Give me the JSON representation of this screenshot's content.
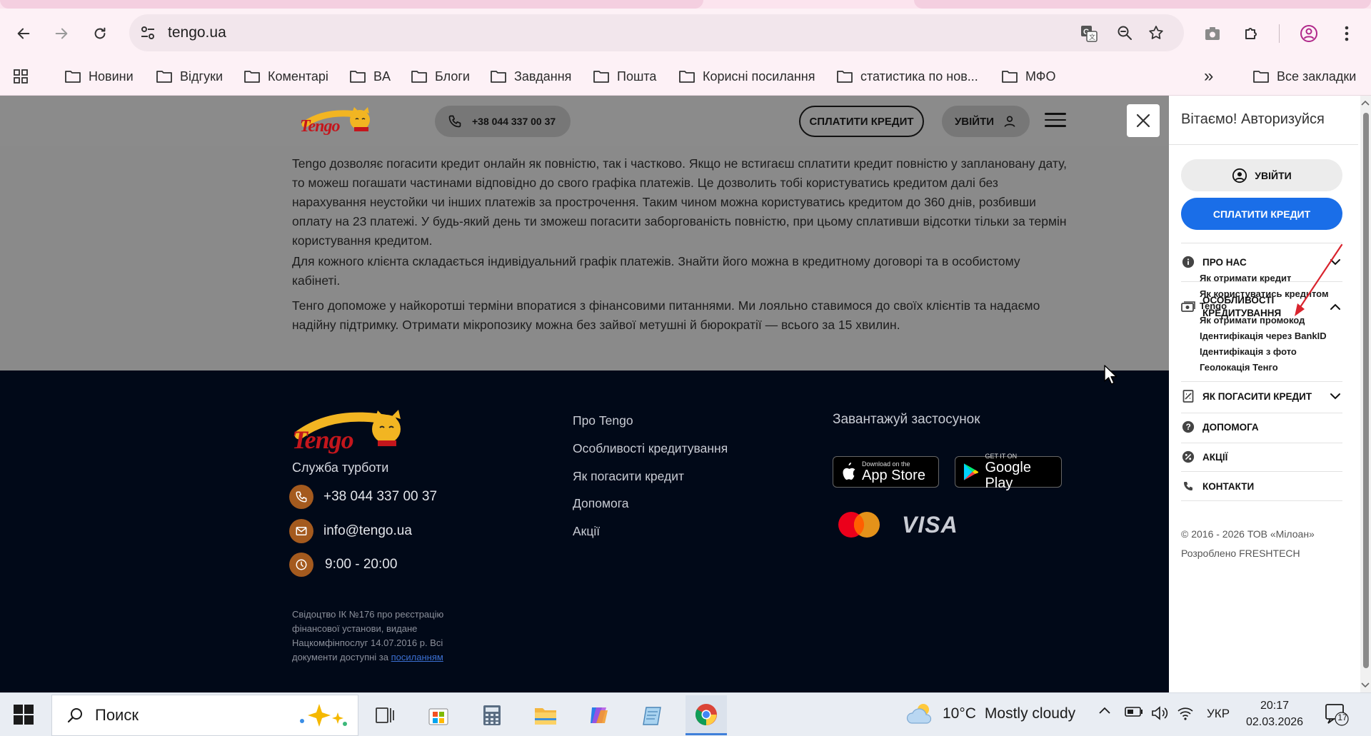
{
  "browser": {
    "url": "tengo.ua",
    "bookmarks": [
      "Новини",
      "Відгуки",
      "Коментарі",
      "BA",
      "Блоги",
      "Завдання",
      "Пошта",
      "Корисні посилання",
      "статистика по нов...",
      "МФО"
    ],
    "all_bookmarks": "Все закладки",
    "more_glyph": "»"
  },
  "site": {
    "logo_text": "Tengo",
    "phone": "+38 044 337 00 37",
    "pay_label": "СПЛАТИТИ КРЕДИТ",
    "login_label": "УВІЙТИ",
    "paragraphs": [
      "Tengo дозволяє погасити кредит онлайн як повністю, так і частково. Якщо не встигаєш сплатити кредит повністю у заплановану дату, то можеш погашати частинами відповідно до свого графіка платежів. Це дозволить тобі користуватись кредитом далі без нарахування неустойки чи інших платежів за прострочення. Таким чином можна користуватись кредитом до 360 днів, розбивши оплату на 23 платежі. У будь-який день ти зможеш погасити заборгованість повністю, при цьому сплативши відсотки тільки за термін користування кредитом.",
      "Для кожного клієнта складається індивідуальний графік платежів. Знайти його можна в кредитному договорі та в особистому кабінеті.",
      "Тенго допоможе у найкоротші терміни впоратися з фінансовими питаннями. Ми лояльно ставимося до своїх клієнтів та надаємо надійну підтримку. Отримати мікропозику можна без зайвої метушні й бюрократії — всього за 15 хвилин."
    ]
  },
  "footer": {
    "service_title": "Служба турботи",
    "phone": "+38 044 337 00 37",
    "email": "info@tengo.ua",
    "hours": "9:00 - 20:00",
    "license_text": "Свідоцтво ІК №176 про реєстрацію фінансової установи, видане Нацкомфінпослуг 14.07.2016 р. Всі документи доступні за",
    "license_link": "посиланням",
    "links": [
      "Про Tengo",
      "Особливості кредитування",
      "Як погасити кредит",
      "Допомога",
      "Акції"
    ],
    "app_title": "Завантажуй застосунок",
    "appstore_small": "Download on the",
    "appstore_big": "App Store",
    "gplay_small": "GET IT ON",
    "gplay_big": "Google Play",
    "visa": "VISA"
  },
  "panel": {
    "greeting": "Вітаємо! Авторизуйся",
    "login": "УВІЙТИ",
    "pay": "СПЛАТИТИ КРЕДИТ",
    "about": "ПРО НАС",
    "features_line1": "ОСОБЛИВОСТІ",
    "features_line2": "КРЕДИТУВАННЯ",
    "subitems": [
      "Як отримати кредит",
      "Як користуватись кредитом Tengo",
      "Як отримати промокод",
      "Ідентифікація через BankID",
      "Ідентифікація з фото",
      "Геолокація Тенго"
    ],
    "repay": "ЯК ПОГАСИТИ КРЕДИТ",
    "help": "ДОПОМОГА",
    "promo": "АКЦІЇ",
    "contacts": "КОНТАКТИ",
    "copyright": "© 2016 - 2026 ТОВ «Мілоан»",
    "developer": "Розроблено FRESHTECH"
  },
  "taskbar": {
    "search_placeholder": "Поиск",
    "temperature": "10°C",
    "weather": "Mostly cloudy",
    "lang": "УКР",
    "time": "20:17",
    "date": "02.03.2026",
    "notifications": "17"
  },
  "colors": {
    "accent_blue": "#1a6ee8",
    "brand_red": "#c4161c",
    "footer_bg": "#010918",
    "annotation_arrow": "#d9232d"
  }
}
